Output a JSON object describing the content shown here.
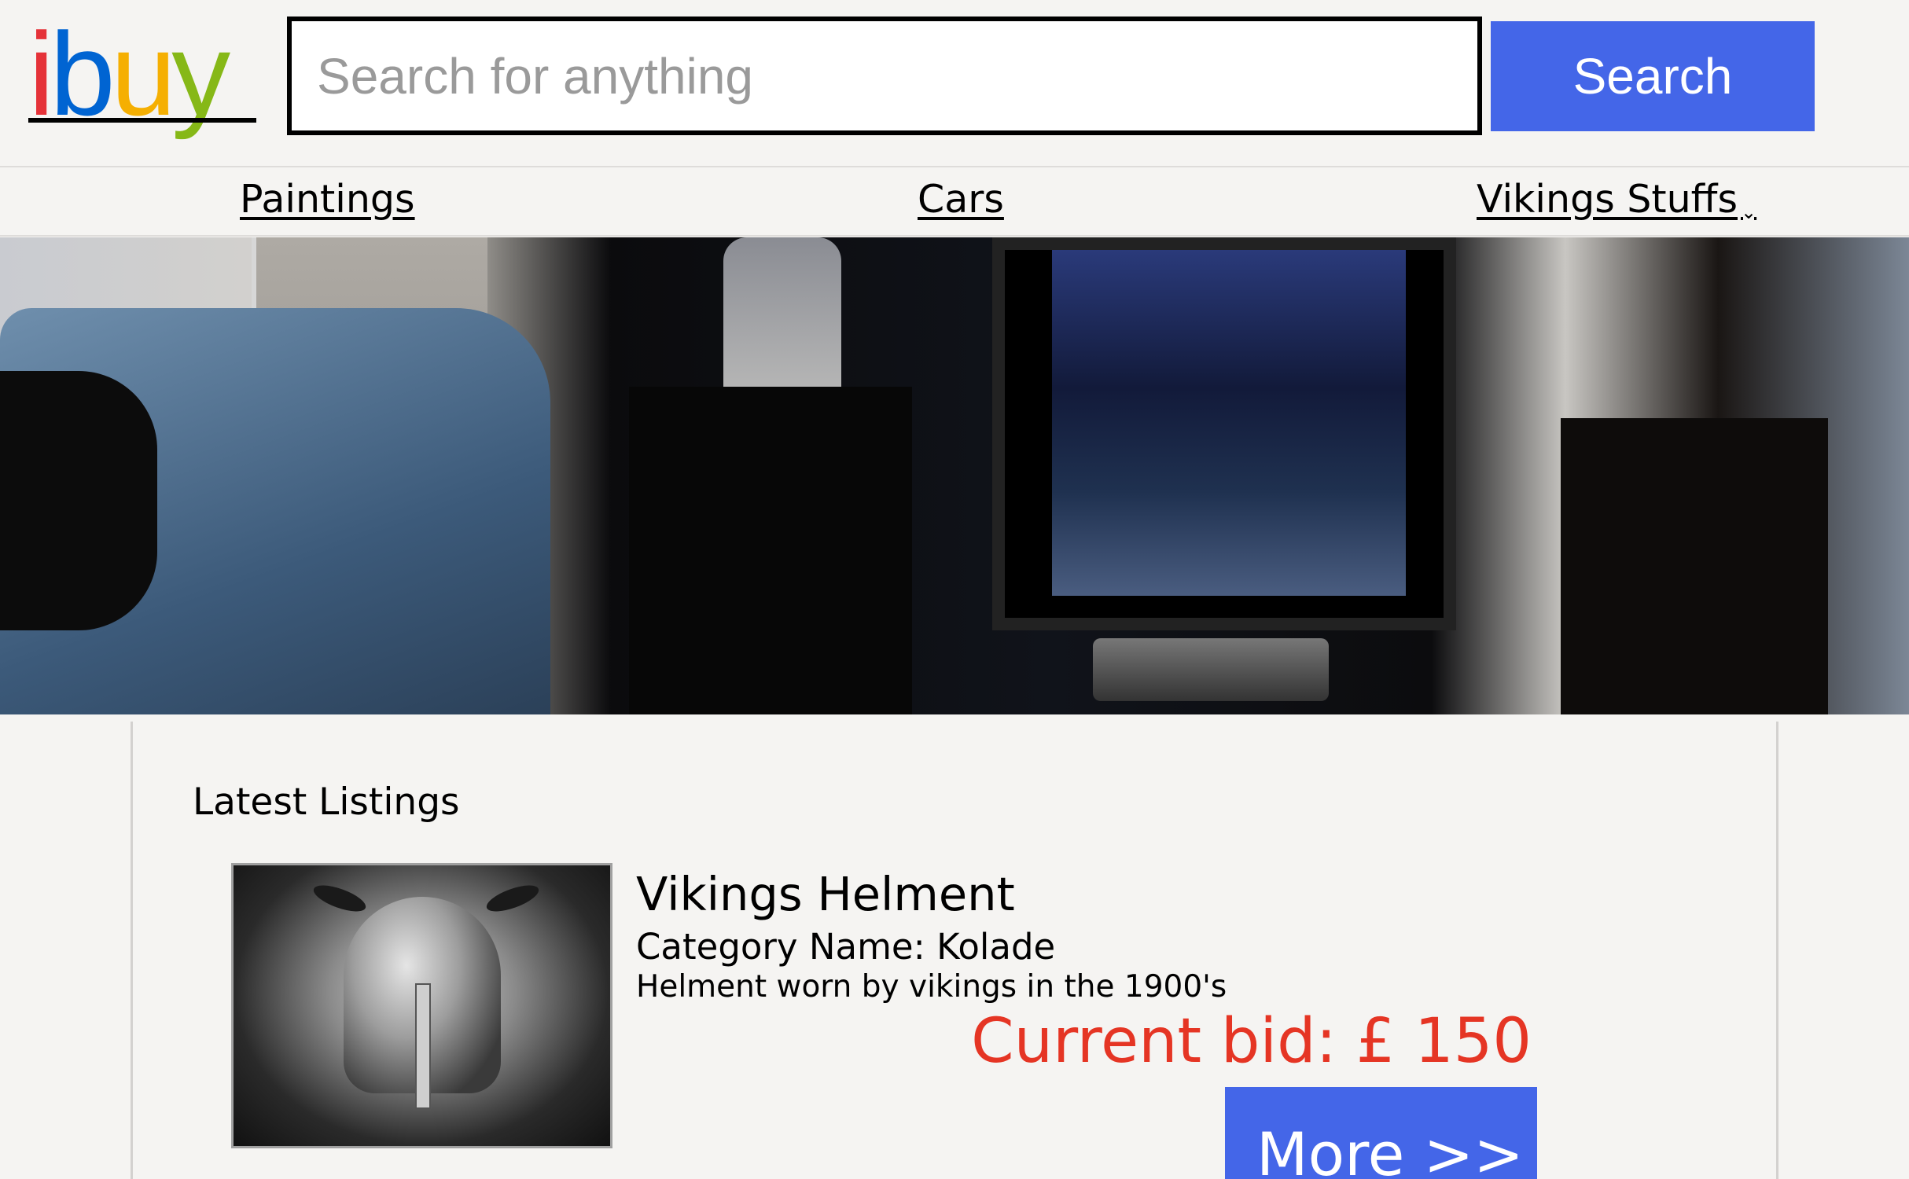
{
  "brand": {
    "logo_letters": [
      {
        "char": "i",
        "color": "#e53238"
      },
      {
        "char": "b",
        "color": "#0064d2"
      },
      {
        "char": "u",
        "color": "#f5af02"
      },
      {
        "char": "y",
        "color": "#86b817"
      }
    ]
  },
  "search": {
    "placeholder": "Search for anything",
    "value": "",
    "button_label": "Search"
  },
  "nav": {
    "items": [
      {
        "label": "Paintings"
      },
      {
        "label": "Cars"
      },
      {
        "label": "Vikings Stuffs"
      }
    ]
  },
  "main": {
    "section_title": "Latest Listings",
    "listings": [
      {
        "title": "Vikings Helment",
        "category": "Category Name: Kolade",
        "description": "Helment worn by vikings in the 1900's",
        "bid": "Current bid: £ 150",
        "more_label": "More >>"
      }
    ]
  },
  "colors": {
    "accent": "#4466e8",
    "bid": "#e53524",
    "background": "#f5f4f2"
  }
}
